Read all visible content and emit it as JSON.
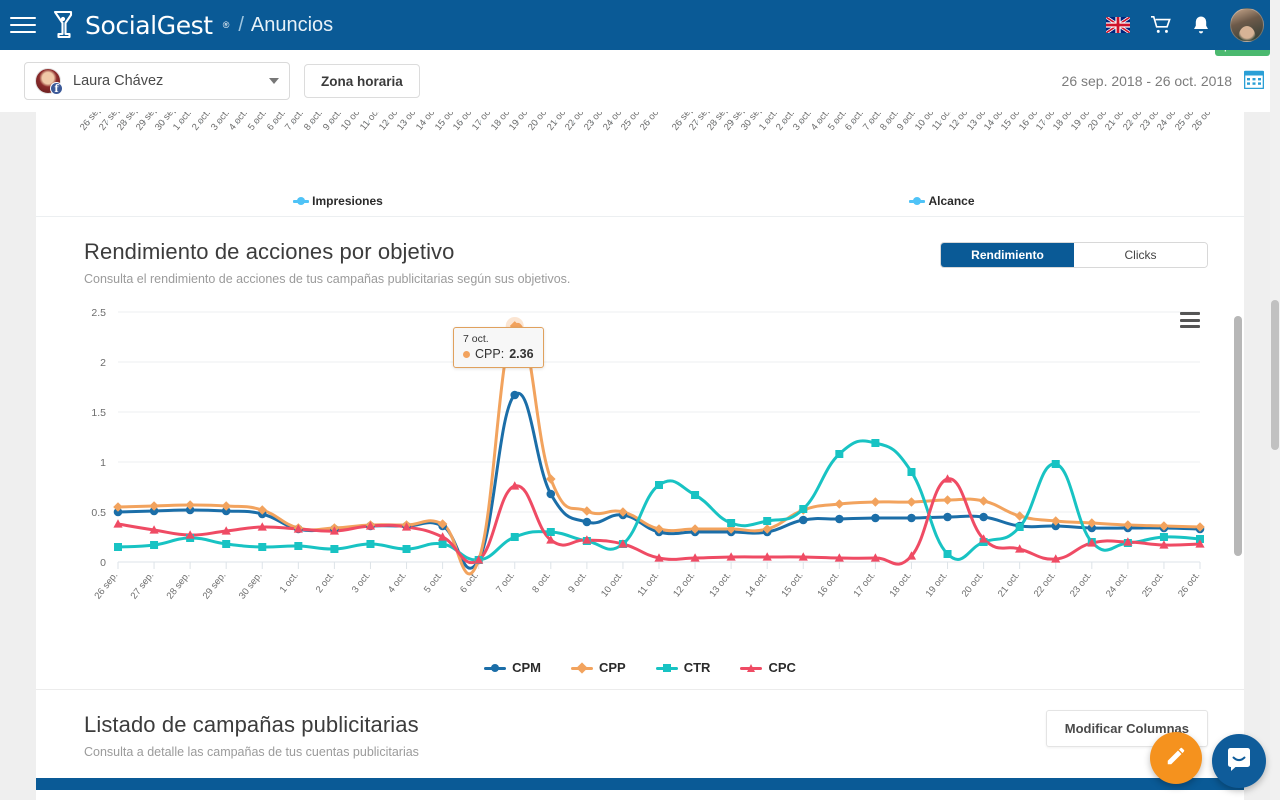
{
  "topnav": {
    "menu_icon": "hamburger-menu-icon",
    "brand": "SocialGest",
    "brand_reg": "®",
    "separator": "/",
    "page": "Anuncios",
    "flag_icon": "uk-flag-icon",
    "cart_icon": "shopping-cart-icon",
    "bell_icon": "notification-bell-icon",
    "avatar_icon": "user-avatar"
  },
  "subbar": {
    "account_name": "Laura Chávez",
    "account_network_icon": "facebook-icon",
    "caret_icon": "chevron-down-icon",
    "timezone_button": "Zona horaria",
    "date_range": "26 sep. 2018 - 26 oct. 2018",
    "calendar_icon": "calendar-icon",
    "new_badge": "¡Nuevo!"
  },
  "mini_charts": [
    {
      "legend": "Impresiones",
      "color": "#4fc3f7"
    },
    {
      "legend": "Alcance",
      "color": "#4fc3f7"
    }
  ],
  "mini_x_labels": [
    "26 sep.",
    "27 sep.",
    "28 sep.",
    "29 sep.",
    "30 sep.",
    "1 oct.",
    "2 oct.",
    "3 oct.",
    "4 oct.",
    "5 oct.",
    "6 oct.",
    "7 oct.",
    "8 oct.",
    "9 oct.",
    "10 oct.",
    "11 oct.",
    "12 oct.",
    "13 oct.",
    "14 oct.",
    "15 oct.",
    "16 oct.",
    "17 oct.",
    "18 oct.",
    "19 oct.",
    "20 oct.",
    "21 oct.",
    "22 oct.",
    "23 oct.",
    "24 oct.",
    "25 oct.",
    "26 oct."
  ],
  "performance_section": {
    "title": "Rendimiento de acciones por objetivo",
    "subtitle": "Consulta el rendimiento de acciones de tus campañas publicitarias según sus objetivos.",
    "toggle": {
      "active": "Rendimiento",
      "inactive": "Clicks"
    },
    "menu_icon": "chart-context-menu-icon"
  },
  "tooltip": {
    "date": "7 oct.",
    "series": "CPP",
    "label": "CPP:",
    "value": "2.36",
    "color": "#f2a35e"
  },
  "campaigns_section": {
    "title": "Listado de campañas publicitarias",
    "subtitle": "Consulta a detalle las campañas de tus cuentas publicitarias",
    "modify_columns": "Modificar Columnas"
  },
  "fabs": {
    "edit_icon": "pencil-edit-icon",
    "chat_icon": "intercom-chat-icon"
  },
  "colors": {
    "brand_blue": "#0a5a96",
    "cpm": "#1b6ea8",
    "cpp": "#f2a35e",
    "ctr": "#18c3c3",
    "cpc": "#ef4b64",
    "accent_orange": "#f5921e",
    "badge_green": "#4bb96f"
  },
  "chart_data": {
    "type": "line",
    "title": "Rendimiento de acciones por objetivo",
    "xlabel": "",
    "ylabel": "",
    "ylim": [
      0,
      2.5
    ],
    "yticks": [
      0,
      0.5,
      1,
      1.5,
      2,
      2.5
    ],
    "ytick_labels": [
      "0",
      "0.5",
      "1",
      "1.5",
      "2",
      "2.5"
    ],
    "grid": true,
    "legend_position": "bottom",
    "categories": [
      "26 sep.",
      "27 sep.",
      "28 sep.",
      "29 sep.",
      "30 sep.",
      "1 oct.",
      "2 oct.",
      "3 oct.",
      "4 oct.",
      "5 oct.",
      "6 oct.",
      "7 oct.",
      "8 oct.",
      "9 oct.",
      "10 oct.",
      "11 oct.",
      "12 oct.",
      "13 oct.",
      "14 oct.",
      "15 oct.",
      "16 oct.",
      "17 oct.",
      "18 oct.",
      "19 oct.",
      "20 oct.",
      "21 oct.",
      "22 oct.",
      "23 oct.",
      "24 oct.",
      "25 oct.",
      "26 oct."
    ],
    "series": [
      {
        "name": "CPM",
        "color": "#1b6ea8",
        "marker": "circle",
        "values": [
          0.5,
          0.51,
          0.52,
          0.51,
          0.48,
          0.33,
          0.33,
          0.36,
          0.36,
          0.36,
          0.02,
          1.67,
          0.68,
          0.4,
          0.47,
          0.3,
          0.3,
          0.3,
          0.3,
          0.42,
          0.43,
          0.44,
          0.44,
          0.45,
          0.45,
          0.36,
          0.36,
          0.34,
          0.34,
          0.34,
          0.33
        ]
      },
      {
        "name": "CPP",
        "color": "#f2a35e",
        "marker": "diamond",
        "values": [
          0.55,
          0.56,
          0.57,
          0.56,
          0.52,
          0.34,
          0.34,
          0.37,
          0.37,
          0.38,
          0.02,
          2.36,
          0.83,
          0.51,
          0.5,
          0.33,
          0.33,
          0.33,
          0.33,
          0.52,
          0.58,
          0.6,
          0.6,
          0.62,
          0.61,
          0.46,
          0.41,
          0.39,
          0.37,
          0.36,
          0.35
        ]
      },
      {
        "name": "CTR",
        "color": "#18c3c3",
        "marker": "square",
        "values": [
          0.15,
          0.17,
          0.24,
          0.18,
          0.15,
          0.16,
          0.13,
          0.18,
          0.13,
          0.18,
          0.02,
          0.25,
          0.3,
          0.21,
          0.18,
          0.77,
          0.67,
          0.39,
          0.41,
          0.53,
          1.08,
          1.19,
          0.9,
          0.08,
          0.2,
          0.35,
          0.98,
          0.2,
          0.19,
          0.25,
          0.23
        ]
      },
      {
        "name": "CPC",
        "color": "#ef4b64",
        "marker": "triangle",
        "values": [
          0.38,
          0.32,
          0.27,
          0.31,
          0.35,
          0.33,
          0.31,
          0.36,
          0.35,
          0.25,
          0.02,
          0.76,
          0.22,
          0.22,
          0.18,
          0.04,
          0.04,
          0.05,
          0.05,
          0.05,
          0.04,
          0.04,
          0.06,
          0.83,
          0.23,
          0.13,
          0.03,
          0.19,
          0.2,
          0.17,
          0.18
        ]
      }
    ]
  }
}
